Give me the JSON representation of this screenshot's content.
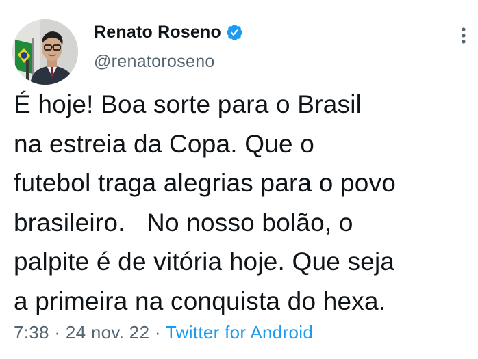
{
  "author": {
    "display_name": "Renato Roseno",
    "handle": "@renatoroseno",
    "verified": true,
    "avatar": "profile-photo-man-glasses-suit-brazil-flag"
  },
  "tweet": {
    "lines": [
      "É hoje! Boa sorte para o Brasil",
      "na estreia da Copa. Que o",
      "futebol traga alegrias para o povo",
      "brasileiro.   No nosso bolão, o",
      "palpite é de vitória hoje. Que seja",
      "a primeira na conquista do hexa."
    ]
  },
  "meta": {
    "time": "7:38",
    "separator": " · ",
    "date": "24 nov. 22",
    "source": "Twitter for Android"
  },
  "icons": {
    "verified_badge": "verified-badge-icon",
    "more": "more-options-icon"
  },
  "colors": {
    "text": "#0f1419",
    "secondary": "#536471",
    "accent": "#1d9bf0"
  }
}
